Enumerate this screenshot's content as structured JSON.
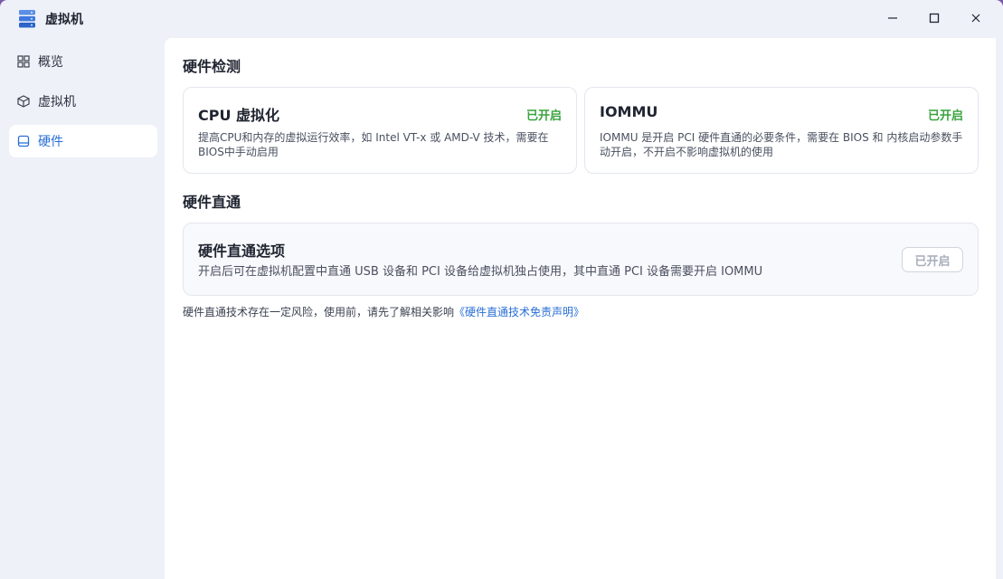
{
  "window": {
    "title": "虚拟机",
    "controls": {
      "minimize": "minimize-icon",
      "maximize": "maximize-icon",
      "close": "close-icon"
    }
  },
  "sidebar": {
    "items": [
      {
        "label": "概览",
        "icon": "grid-icon",
        "active": false
      },
      {
        "label": "虚拟机",
        "icon": "cube-icon",
        "active": false
      },
      {
        "label": "硬件",
        "icon": "drive-icon",
        "active": true
      }
    ]
  },
  "detection": {
    "title": "硬件检测",
    "cards": [
      {
        "title": "CPU 虚拟化",
        "status": "已开启",
        "desc_line1": "提高CPU和内存的虚拟运行效率，如 Intel VT-x 或 AMD-V 技术，需要在",
        "desc_line2": "BIOS中手动启用"
      },
      {
        "title": "IOMMU",
        "status": "已开启",
        "desc_line1": "IOMMU 是开启 PCI 硬件直通的必要条件，需要在 BIOS 和 内核启动参数手",
        "desc_line2": "动开启，不开启不影响虚拟机的使用"
      }
    ]
  },
  "passthrough": {
    "title": "硬件直通",
    "card": {
      "title": "硬件直通选项",
      "desc": "开启后可在虚拟机配置中直通 USB 设备和 PCI 设备给虚拟机独占使用，其中直通 PCI 设备需要开启 IOMMU",
      "button": "已开启"
    }
  },
  "note": {
    "text": "硬件直通技术存在一定风险，使用前，请先了解相关影响",
    "link": "《硬件直通技术免责声明》"
  },
  "colors": {
    "accent": "#2a6fd6",
    "success": "#3aa33f",
    "sidebar_bg": "#eef1f8"
  }
}
